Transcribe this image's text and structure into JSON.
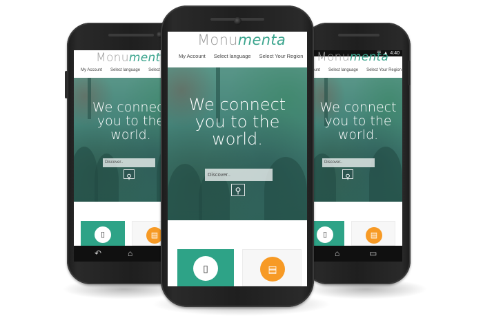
{
  "brand": {
    "part1": "Monu",
    "part2": "menta",
    "accent": "#3aa48d"
  },
  "menu": [
    "My Account",
    "Select language",
    "Select Your Region"
  ],
  "hero": {
    "tagline_line1": "We connect",
    "tagline_line2": "you to the",
    "tagline_line3": "world."
  },
  "search": {
    "placeholder": "Discover..",
    "button_icon": "search-icon"
  },
  "features": [
    {
      "icon": "mobile-phone-icon",
      "color": "#2ea387"
    },
    {
      "icon": "laptop-icon",
      "color": "#f79a25"
    }
  ],
  "status": {
    "time": "4:40"
  },
  "nav_icons": [
    "back-icon",
    "home-icon",
    "recent-apps-icon"
  ]
}
